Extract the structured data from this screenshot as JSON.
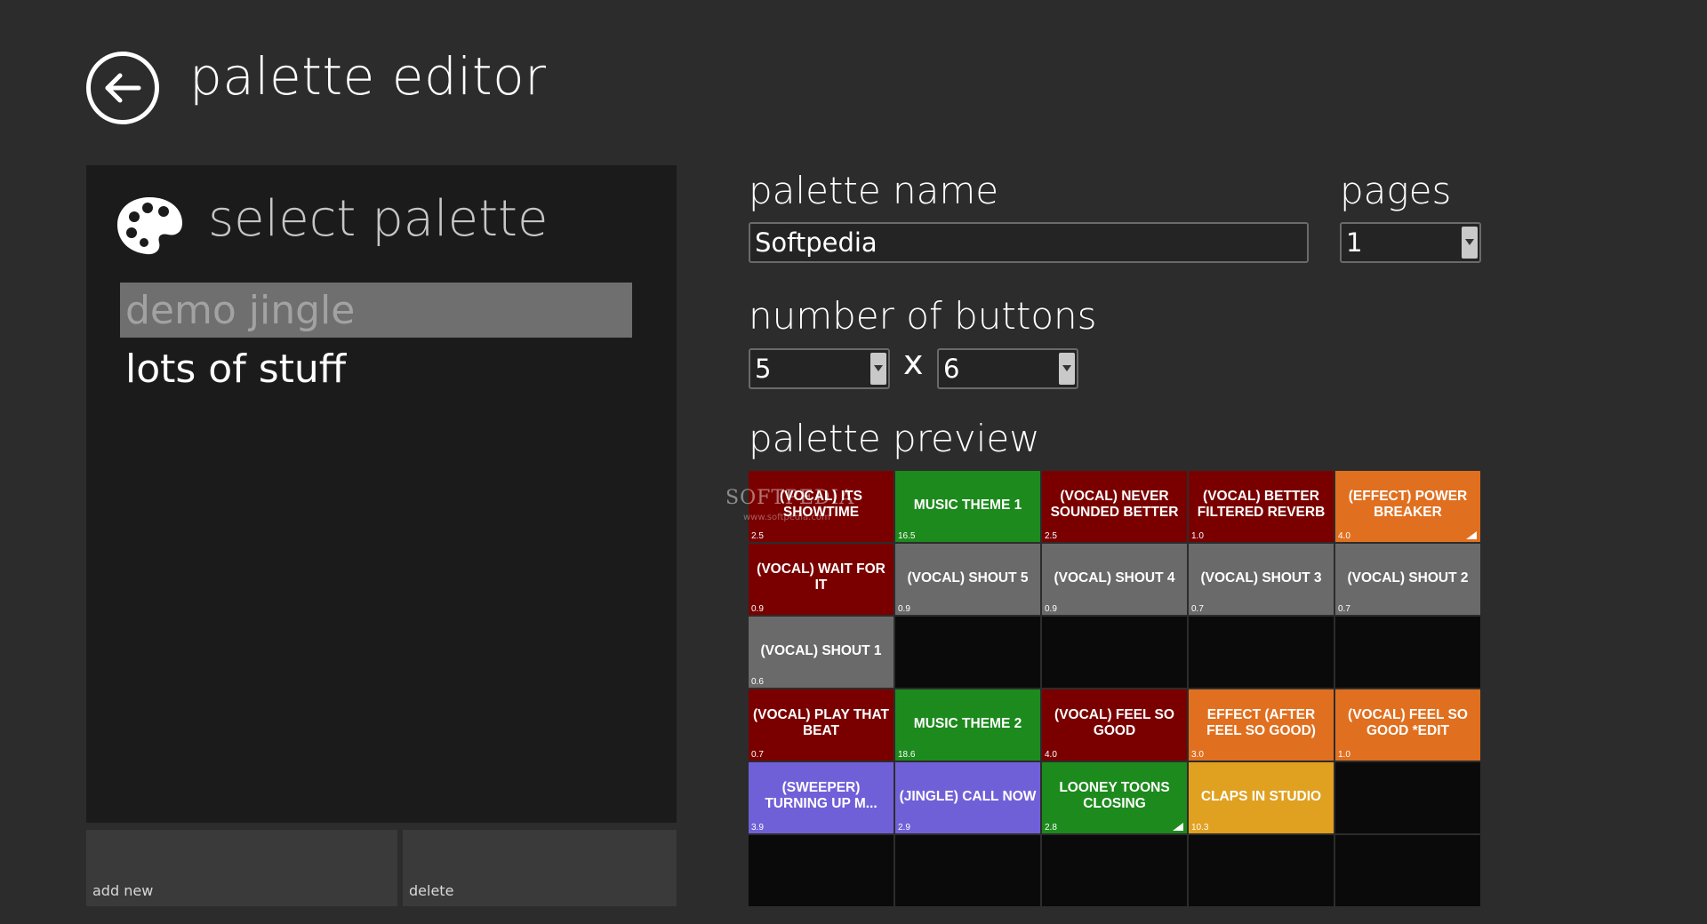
{
  "header": {
    "title": "palette editor"
  },
  "sidebar": {
    "heading": "select palette",
    "items": [
      {
        "label": "demo jingle",
        "selected": true
      },
      {
        "label": "lots of stuff",
        "selected": false
      }
    ],
    "add_label": "add new",
    "delete_label": "delete"
  },
  "form": {
    "palette_name_label": "palette name",
    "palette_name_value": "Softpedia",
    "pages_label": "pages",
    "pages_value": "1",
    "buttons_label": "number of buttons",
    "rows_value": "5",
    "times": "x",
    "cols_value": "6",
    "preview_label": "palette preview"
  },
  "watermark": {
    "text": "SOFTPEDIA",
    "sub": "www.softpedia.com"
  },
  "colors": {
    "red": "#7a0000",
    "green": "#1d8a1d",
    "gray": "#6a6a6a",
    "orange": "#e07020",
    "purple": "#7060d8",
    "gold": "#e0a020",
    "empty": "#0a0a0a"
  },
  "grid": {
    "cells": [
      {
        "label": "(VOCAL) ITS SHOWTIME",
        "duration": "2.5",
        "color": "red"
      },
      {
        "label": "MUSIC THEME 1",
        "duration": "16.5",
        "color": "green"
      },
      {
        "label": "(VOCAL) NEVER SOUNDED BETTER",
        "duration": "2.5",
        "color": "red"
      },
      {
        "label": "(VOCAL) BETTER FILTERED REVERB",
        "duration": "1.0",
        "color": "red"
      },
      {
        "label": "(EFFECT) POWER BREAKER",
        "duration": "4.0",
        "color": "orange",
        "corner": true
      },
      {
        "label": "(VOCAL) WAIT FOR IT",
        "duration": "0.9",
        "color": "red"
      },
      {
        "label": "(VOCAL) SHOUT 5",
        "duration": "0.9",
        "color": "gray"
      },
      {
        "label": "(VOCAL) SHOUT 4",
        "duration": "0.9",
        "color": "gray"
      },
      {
        "label": "(VOCAL) SHOUT 3",
        "duration": "0.7",
        "color": "gray"
      },
      {
        "label": "(VOCAL) SHOUT 2",
        "duration": "0.7",
        "color": "gray"
      },
      {
        "label": "(VOCAL) SHOUT 1",
        "duration": "0.6",
        "color": "gray"
      },
      {
        "label": "",
        "duration": "",
        "color": "empty"
      },
      {
        "label": "",
        "duration": "",
        "color": "empty"
      },
      {
        "label": "",
        "duration": "",
        "color": "empty"
      },
      {
        "label": "",
        "duration": "",
        "color": "empty"
      },
      {
        "label": "(VOCAL) PLAY THAT BEAT",
        "duration": "0.7",
        "color": "red"
      },
      {
        "label": "MUSIC THEME 2",
        "duration": "18.6",
        "color": "green"
      },
      {
        "label": "(VOCAL) FEEL SO GOOD",
        "duration": "4.0",
        "color": "red"
      },
      {
        "label": "EFFECT (AFTER FEEL SO GOOD)",
        "duration": "3.0",
        "color": "orange"
      },
      {
        "label": "(VOCAL) FEEL SO GOOD *EDIT",
        "duration": "1.0",
        "color": "orange"
      },
      {
        "label": "(SWEEPER) TURNING UP M...",
        "duration": "3.9",
        "color": "purple"
      },
      {
        "label": "(JINGLE) CALL NOW",
        "duration": "2.9",
        "color": "purple"
      },
      {
        "label": "LOONEY TOONS CLOSING",
        "duration": "2.8",
        "color": "green",
        "corner": true
      },
      {
        "label": "CLAPS IN STUDIO",
        "duration": "10.3",
        "color": "gold"
      },
      {
        "label": "",
        "duration": "",
        "color": "empty"
      },
      {
        "label": "",
        "duration": "",
        "color": "empty"
      },
      {
        "label": "",
        "duration": "",
        "color": "empty"
      },
      {
        "label": "",
        "duration": "",
        "color": "empty"
      },
      {
        "label": "",
        "duration": "",
        "color": "empty"
      },
      {
        "label": "",
        "duration": "",
        "color": "empty"
      }
    ]
  }
}
